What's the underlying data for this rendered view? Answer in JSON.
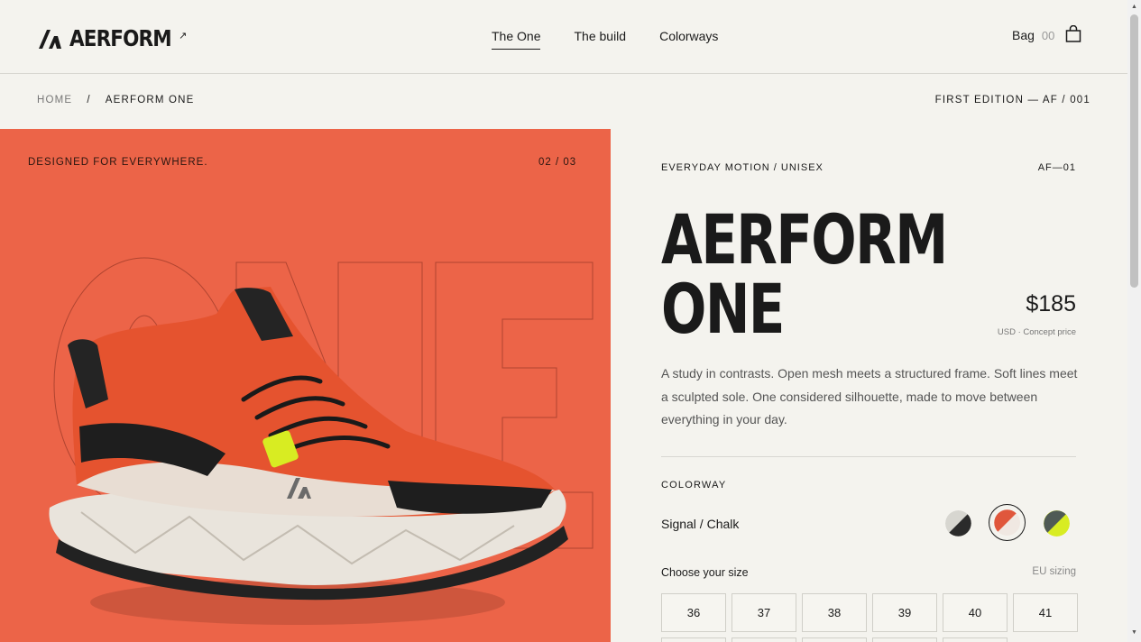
{
  "header": {
    "brand": "AERFORM",
    "nav": [
      "The One",
      "The build",
      "Colorways"
    ],
    "bag_label": "Bag",
    "bag_count": "00"
  },
  "breadcrumb": {
    "home": "HOME",
    "sep": "/",
    "current": "AERFORM ONE"
  },
  "edition": "FIRST EDITION — AF / 001",
  "hero": {
    "tagline": "DESIGNED FOR EVERYWHERE.",
    "counter": "02 / 03",
    "bg_color": "#ec6448",
    "watermark": "ONE"
  },
  "product": {
    "eyebrow": "EVERYDAY MOTION / UNISEX",
    "sku": "AF—01",
    "title_line1": "AERFORM",
    "title_line2": "ONE",
    "price": "$185",
    "price_note": "USD · Concept price",
    "description": "A study in contrasts. Open mesh meets a structured frame. Soft lines meet a sculpted sole. One considered silhouette, made to move between everything in your day.",
    "colorway_label": "COLORWAY",
    "colorway_name": "Signal / Chalk",
    "colorways": [
      {
        "name": "Graphite",
        "a": "#2b2b2b",
        "b": "#d7d6d0"
      },
      {
        "name": "Signal / Chalk",
        "a": "#e0573c",
        "b": "#efe6e0",
        "selected": true
      },
      {
        "name": "Volt",
        "a": "#4f5a55",
        "b": "#d8ec22"
      }
    ],
    "size_label": "Choose your size",
    "size_hint": "EU sizing",
    "sizes": [
      "36",
      "37",
      "38",
      "39",
      "40",
      "41"
    ]
  }
}
